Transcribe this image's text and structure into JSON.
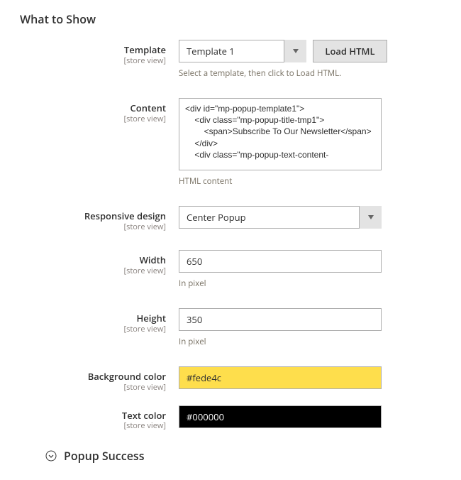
{
  "section_title": "What to Show",
  "scope_label": "[store view]",
  "fields": {
    "template": {
      "label": "Template",
      "value": "Template 1",
      "button": "Load HTML",
      "hint": "Select a template, then click to Load HTML."
    },
    "content": {
      "label": "Content",
      "value": "<div id=\"mp-popup-template1\">\n    <div class=\"mp-popup-title-tmp1\">\n        <span>Subscribe To Our Newsletter</span>\n    </div>\n    <div class=\"mp-popup-text-content-",
      "hint": "HTML content"
    },
    "responsive": {
      "label": "Responsive design",
      "value": "Center Popup"
    },
    "width": {
      "label": "Width",
      "value": "650",
      "hint": "In pixel"
    },
    "height": {
      "label": "Height",
      "value": "350",
      "hint": "In pixel"
    },
    "bgcolor": {
      "label": "Background color",
      "value": "#fede4c"
    },
    "textcolor": {
      "label": "Text color",
      "value": "#000000"
    }
  },
  "collapsible": {
    "title": "Popup Success"
  }
}
